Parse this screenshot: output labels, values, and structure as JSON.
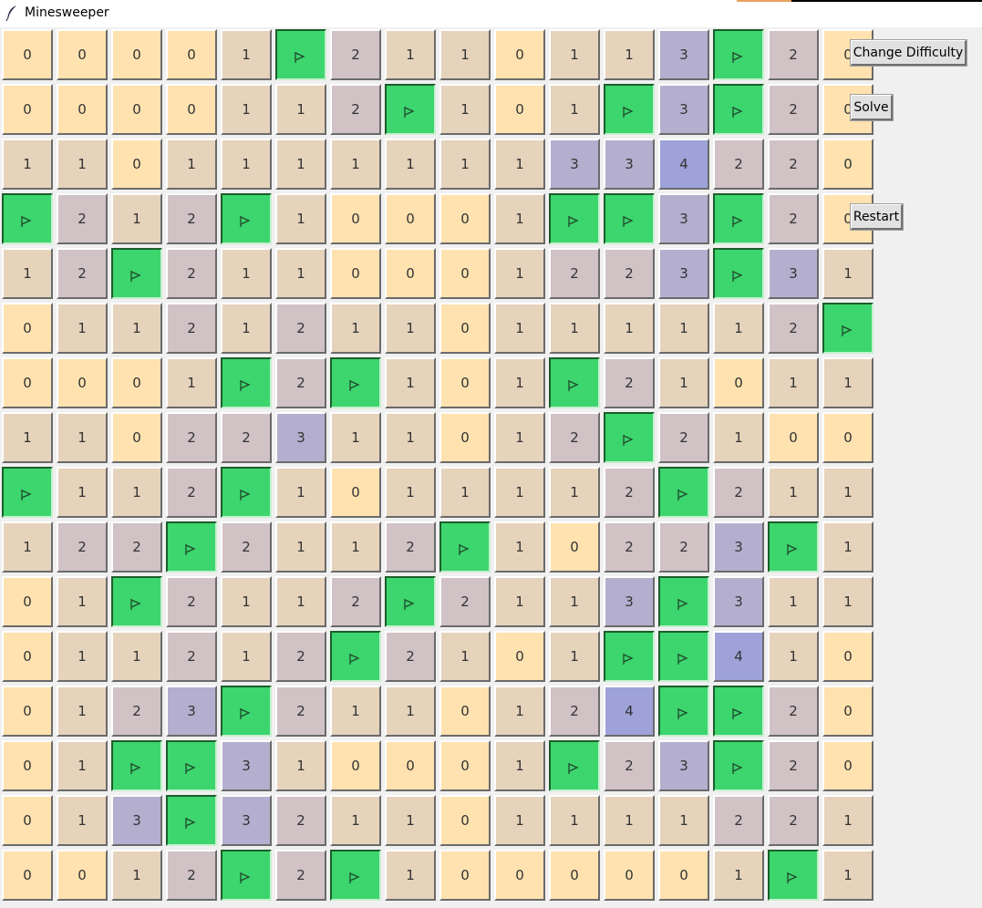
{
  "window": {
    "title": "Minesweeper",
    "icon": "feather-icon"
  },
  "buttons": {
    "change_difficulty": "Change Difficulty",
    "solve": "Solve",
    "restart": "Restart"
  },
  "colors": {
    "0": "#ffe2b0",
    "1": "#e6d3bb",
    "2": "#d1c2c6",
    "3": "#b4afcf",
    "4": "#9ea2d9",
    "F": "#3dd56e",
    "flag_glyph": "#1f4a2c"
  },
  "board": [
    [
      "0",
      "0",
      "0",
      "0",
      "1",
      "F",
      "2",
      "1",
      "1",
      "0",
      "1",
      "1",
      "3",
      "F",
      "2",
      "0"
    ],
    [
      "0",
      "0",
      "0",
      "0",
      "1",
      "1",
      "2",
      "F",
      "1",
      "0",
      "1",
      "F",
      "3",
      "F",
      "2",
      "0"
    ],
    [
      "1",
      "1",
      "0",
      "1",
      "1",
      "1",
      "1",
      "1",
      "1",
      "1",
      "3",
      "3",
      "4",
      "2",
      "2",
      "0"
    ],
    [
      "F",
      "2",
      "1",
      "2",
      "F",
      "1",
      "0",
      "0",
      "0",
      "1",
      "F",
      "F",
      "3",
      "F",
      "2",
      "0"
    ],
    [
      "1",
      "2",
      "F",
      "2",
      "1",
      "1",
      "0",
      "0",
      "0",
      "1",
      "2",
      "2",
      "3",
      "F",
      "3",
      "1"
    ],
    [
      "0",
      "1",
      "1",
      "2",
      "1",
      "2",
      "1",
      "1",
      "0",
      "1",
      "1",
      "1",
      "1",
      "1",
      "2",
      "F"
    ],
    [
      "0",
      "0",
      "0",
      "1",
      "F",
      "2",
      "F",
      "1",
      "0",
      "1",
      "F",
      "2",
      "1",
      "0",
      "1",
      "1"
    ],
    [
      "1",
      "1",
      "0",
      "2",
      "2",
      "3",
      "1",
      "1",
      "0",
      "1",
      "2",
      "F",
      "2",
      "1",
      "0",
      "0"
    ],
    [
      "F",
      "1",
      "1",
      "2",
      "F",
      "1",
      "0",
      "1",
      "1",
      "1",
      "1",
      "2",
      "F",
      "2",
      "1",
      "1"
    ],
    [
      "1",
      "2",
      "2",
      "F",
      "2",
      "1",
      "1",
      "2",
      "F",
      "1",
      "0",
      "2",
      "2",
      "3",
      "F",
      "1"
    ],
    [
      "0",
      "1",
      "F",
      "2",
      "1",
      "1",
      "2",
      "F",
      "2",
      "1",
      "1",
      "3",
      "F",
      "3",
      "1",
      "1"
    ],
    [
      "0",
      "1",
      "1",
      "2",
      "1",
      "2",
      "F",
      "2",
      "1",
      "0",
      "1",
      "F",
      "F",
      "4",
      "1",
      "0"
    ],
    [
      "0",
      "1",
      "2",
      "3",
      "F",
      "2",
      "1",
      "1",
      "0",
      "1",
      "2",
      "4",
      "F",
      "F",
      "2",
      "0"
    ],
    [
      "0",
      "1",
      "F",
      "F",
      "3",
      "1",
      "0",
      "0",
      "0",
      "1",
      "F",
      "2",
      "3",
      "F",
      "2",
      "0"
    ],
    [
      "0",
      "1",
      "3",
      "F",
      "3",
      "2",
      "1",
      "1",
      "0",
      "1",
      "1",
      "1",
      "1",
      "2",
      "2",
      "1"
    ],
    [
      "0",
      "0",
      "1",
      "2",
      "F",
      "2",
      "F",
      "1",
      "0",
      "0",
      "0",
      "0",
      "0",
      "1",
      "F",
      "1"
    ]
  ]
}
